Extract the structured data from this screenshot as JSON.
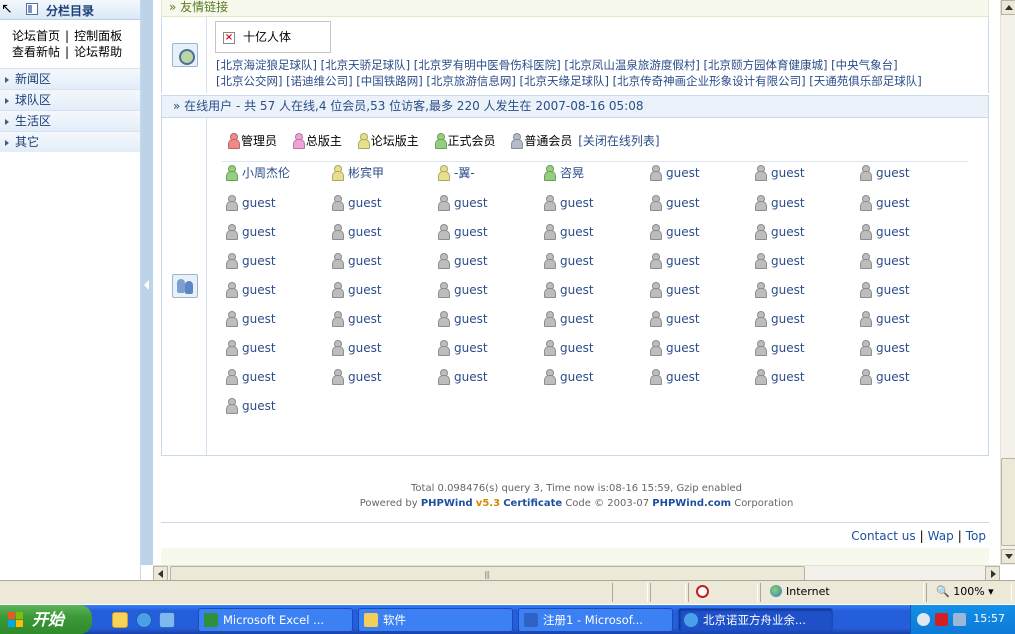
{
  "sidebar": {
    "title": "分栏目录",
    "links_row1": [
      "论坛首页",
      "控制面板"
    ],
    "links_row2": [
      "查看新帖",
      "论坛帮助"
    ],
    "categories": [
      "新闻区",
      "球队区",
      "生活区",
      "其它"
    ]
  },
  "friend_links": {
    "heading": "» 友情链接",
    "logo_text": "十亿人体",
    "row1": "[北京海淀狼足球队] [北京天骄足球队] [北京罗有明中医骨伤科医院] [北京凤山温泉旅游度假村] [北京颐方园体育健康城] [中央气象台]",
    "row2": "[北京公交网] [诺迪维公司] [中国铁路网] [北京旅游信息网] [北京天缘足球队] [北京传奇神画企业形象设计有限公司] [天通苑俱乐部足球队]"
  },
  "online": {
    "heading": "» 在线用户 - 共 57 人在线,4 位会员,53 位访客,最多 220 人发生在 2007-08-16 05:08",
    "legend": {
      "admin": "管理员",
      "super_mod": "总版主",
      "mod": "论坛版主",
      "member": "正式会员",
      "normal": "普通会员",
      "close_list": "[关闭在线列表]"
    },
    "users": [
      "小周杰伦",
      "彬宾甲",
      "-翼-",
      "咨晃",
      "guest",
      "guest",
      "guest",
      "guest",
      "guest",
      "guest",
      "guest",
      "guest",
      "guest",
      "guest",
      "guest",
      "guest",
      "guest",
      "guest",
      "guest",
      "guest",
      "guest",
      "guest",
      "guest",
      "guest",
      "guest",
      "guest",
      "guest",
      "guest",
      "guest",
      "guest",
      "guest",
      "guest",
      "guest",
      "guest",
      "guest",
      "guest",
      "guest",
      "guest",
      "guest",
      "guest",
      "guest",
      "guest",
      "guest",
      "guest",
      "guest",
      "guest",
      "guest",
      "guest",
      "guest",
      "guest",
      "guest",
      "guest",
      "guest",
      "guest",
      "guest",
      "guest",
      "guest"
    ],
    "user_kinds": [
      "member",
      "mod",
      "mod",
      "member",
      "guest",
      "guest",
      "guest"
    ]
  },
  "footer": {
    "stats": "Total 0.098476(s) query 3, Time now is:08-16 15:59, Gzip enabled",
    "powered_prefix": "Powered by ",
    "brand": "PHPWind",
    "version": "v5.3",
    "certificate": "Certificate",
    "code_text": " Code © 2003-07 ",
    "site": "PHPWind.com",
    "corp": " Corporation",
    "nav": [
      "Contact us",
      "Wap",
      "Top"
    ]
  },
  "statusbar": {
    "zone": "Internet",
    "zoom": "100%"
  },
  "taskbar": {
    "start": "开始",
    "tasks": [
      "Microsoft Excel ...",
      "软件",
      "注册1 - Microsof...",
      "北京诺亚方舟业余..."
    ],
    "clock": "15:57"
  },
  "colors": {
    "admin": "#f08a8a",
    "super_mod": "#f2a0d8",
    "mod": "#e6e08a",
    "member": "#94d07c",
    "normal": "#b4bccc",
    "guest": "#bdbdbd",
    "link": "#2b4d89",
    "brand": "#1f4f9f"
  }
}
